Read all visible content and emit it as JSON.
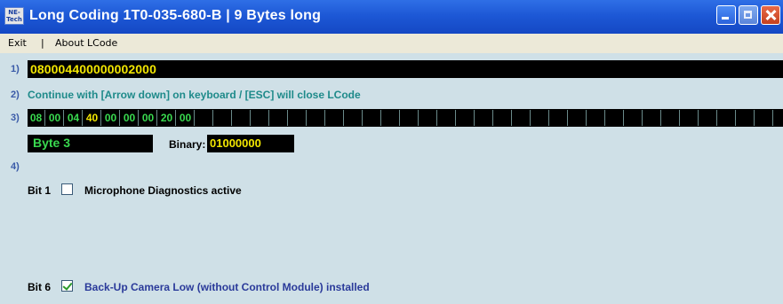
{
  "window": {
    "title": "Long Coding  1T0-035-680-B  |  9 Bytes long",
    "app_icon_text": "NE-Tech"
  },
  "menu": {
    "items": [
      "Exit",
      "About LCode"
    ],
    "separator": "|"
  },
  "rows": {
    "row1_label": "1)",
    "row2_label": "2)",
    "row3_label": "3)",
    "row4_label": "4)"
  },
  "coding_value": "080004400000002000",
  "hint": "Continue with [Arrow down] on keyboard / [ESC] will close LCode",
  "bytes": [
    "08",
    "00",
    "04",
    "40",
    "00",
    "00",
    "00",
    "20",
    "00"
  ],
  "selected_byte_index": 3,
  "empty_cell_count": 33,
  "byte_label": "Byte 3",
  "binary": {
    "label": "Binary:",
    "value": "01000000"
  },
  "bits": [
    {
      "label": "Bit 1",
      "checked": false,
      "desc": "Microphone Diagnostics active"
    },
    {
      "label": "Bit 6",
      "checked": true,
      "desc": "Back-Up Camera Low (without Control Module) installed"
    }
  ],
  "colors": {
    "background": "#cfe0e7",
    "title_bar": "#1d58d6",
    "field_text_yellow": "#f2e600",
    "byte_text_green": "#39d84f",
    "hint_text": "#1e8a8a",
    "checked_bit_text": "#2a3a9a"
  },
  "icons": {
    "app": "ne-tech-logo-icon",
    "minimize": "minimize-icon",
    "maximize": "maximize-icon",
    "close": "close-icon",
    "checkbox_checked": "checkmark-icon"
  }
}
